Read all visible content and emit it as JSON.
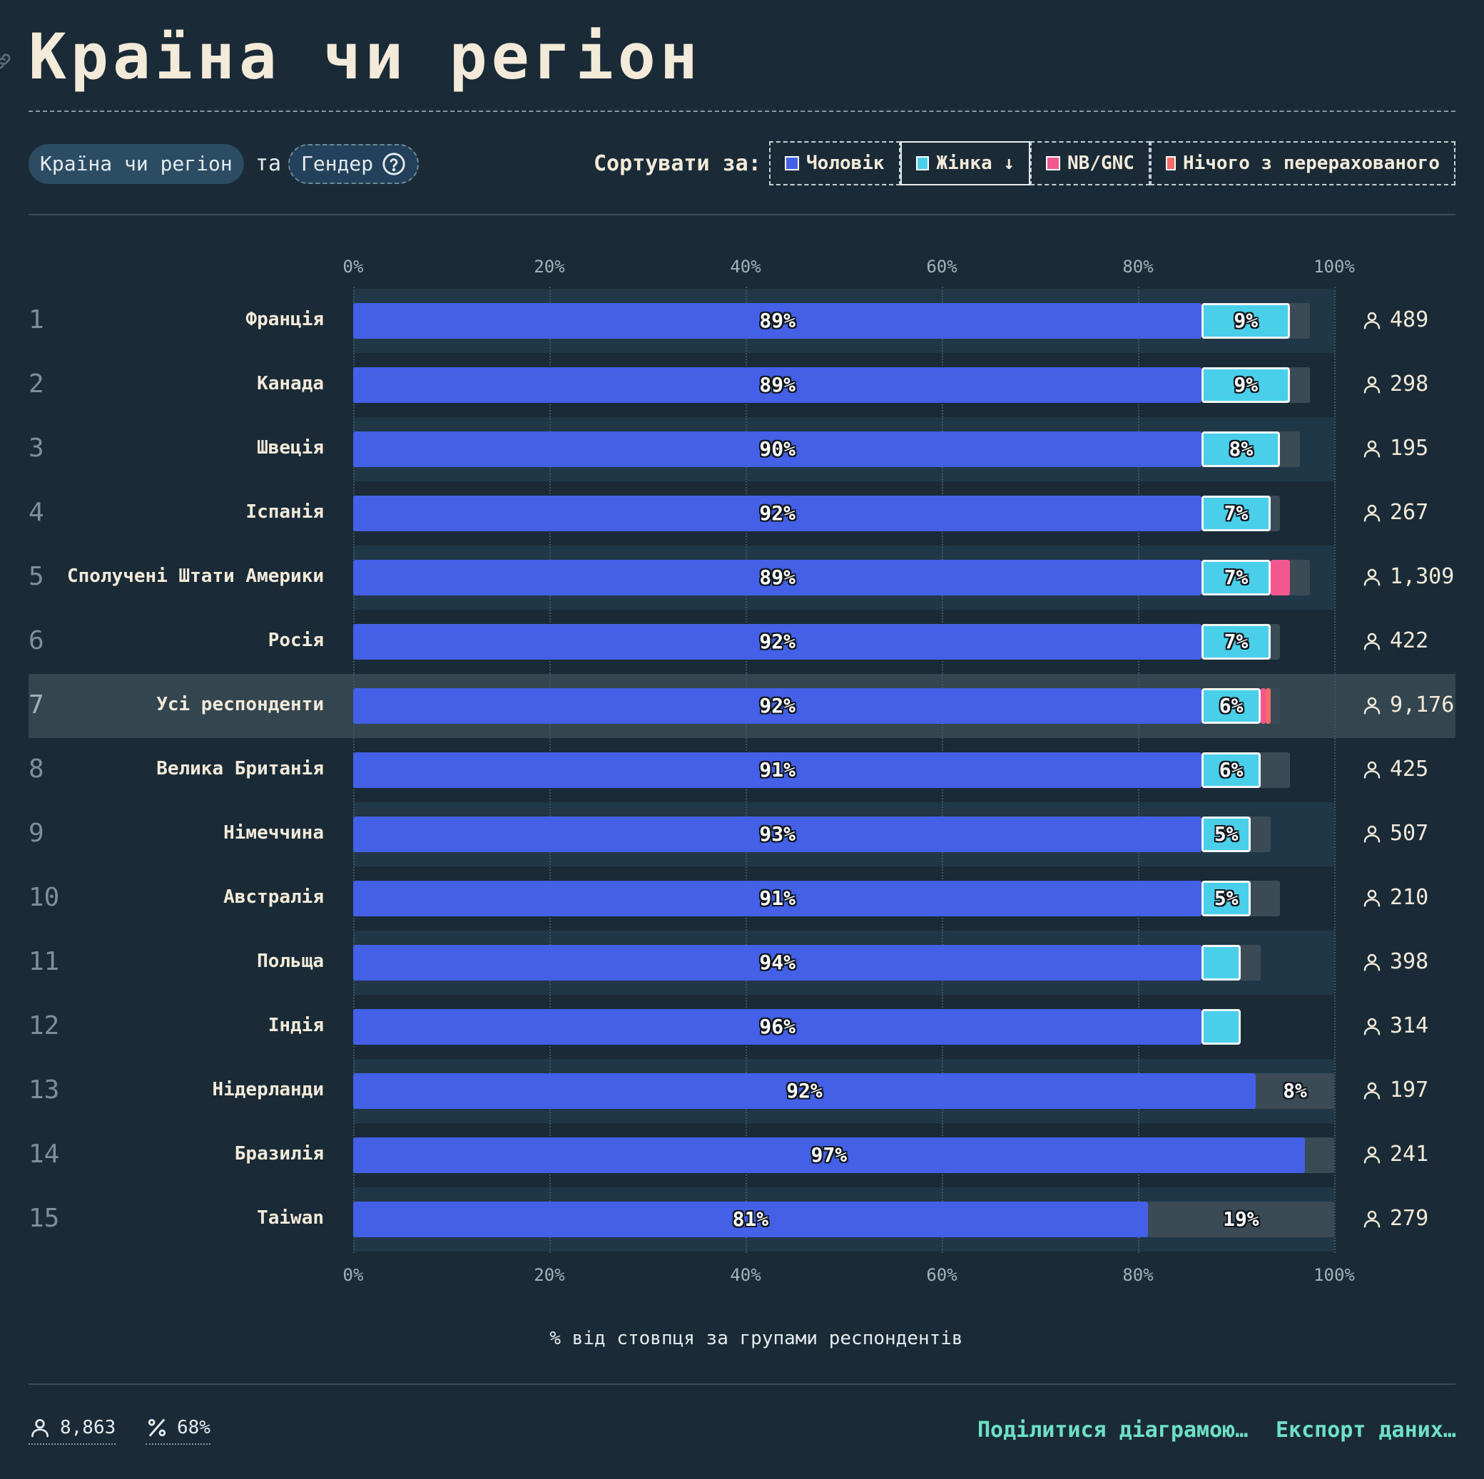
{
  "header": {
    "title": "Країна чи регіон"
  },
  "controls": {
    "group_by_label": "Країна чи регіон",
    "conjunction": "та",
    "breakdown_label": "Гендер",
    "sort_label": "Сортувати за:",
    "sort_options": [
      {
        "label": "Чоловік",
        "color": "#4360e6",
        "active": false
      },
      {
        "label": "Жінка ↓",
        "color": "#49cfea",
        "active": true
      },
      {
        "label": "NB/GNC",
        "color": "#f2578f",
        "active": false
      },
      {
        "label": "Нічого з перерахованого",
        "color": "#f76b6b",
        "active": false
      }
    ]
  },
  "chart_data": {
    "type": "bar",
    "orientation": "horizontal",
    "stacked": true,
    "xlabel": "% від стовпця за групами респондентів",
    "xlim": [
      0,
      100
    ],
    "x_ticks": [
      "0%",
      "20%",
      "40%",
      "60%",
      "80%",
      "100%"
    ],
    "legend": [
      "Чоловік",
      "Жінка",
      "NB/GNC",
      "Нічого з перерахованого"
    ],
    "colors": {
      "male": "#4360e6",
      "female": "#49cfea",
      "nb": "#f2578f",
      "none": "#f76b6b",
      "rest": "#3b4b56"
    },
    "rows": [
      {
        "rank": "1",
        "country": "Франція",
        "male": 89,
        "female": 9,
        "nb": 0,
        "none": 0,
        "male_label": "89%",
        "female_label": "9%",
        "count": "489"
      },
      {
        "rank": "2",
        "country": "Канада",
        "male": 89,
        "female": 9,
        "nb": 0,
        "none": 0,
        "male_label": "89%",
        "female_label": "9%",
        "count": "298"
      },
      {
        "rank": "3",
        "country": "Швеція",
        "male": 90,
        "female": 8,
        "nb": 0,
        "none": 0,
        "male_label": "90%",
        "female_label": "8%",
        "count": "195"
      },
      {
        "rank": "4",
        "country": "Іспанія",
        "male": 92,
        "female": 7,
        "nb": 0,
        "none": 0,
        "male_label": "92%",
        "female_label": "7%",
        "count": "267"
      },
      {
        "rank": "5",
        "country": "Сполучені Штати Америки",
        "male": 89,
        "female": 7,
        "nb": 2,
        "none": 0,
        "male_label": "89%",
        "female_label": "7%",
        "count": "1,309"
      },
      {
        "rank": "6",
        "country": "Росія",
        "male": 92,
        "female": 7,
        "nb": 0,
        "none": 0,
        "male_label": "92%",
        "female_label": "7%",
        "count": "422"
      },
      {
        "rank": "7",
        "country": "Усі респонденти",
        "male": 92,
        "female": 6,
        "nb": 0.5,
        "none": 0.5,
        "male_label": "92%",
        "female_label": "6%",
        "count": "9,176",
        "highlight": true
      },
      {
        "rank": "8",
        "country": "Велика Британія",
        "male": 91,
        "female": 6,
        "nb": 0,
        "none": 0,
        "male_label": "91%",
        "female_label": "6%",
        "count": "425"
      },
      {
        "rank": "9",
        "country": "Німеччина",
        "male": 93,
        "female": 5,
        "nb": 0,
        "none": 0,
        "male_label": "93%",
        "female_label": "5%",
        "count": "507"
      },
      {
        "rank": "10",
        "country": "Австралія",
        "male": 91,
        "female": 5,
        "nb": 0,
        "none": 0,
        "male_label": "91%",
        "female_label": "5%",
        "count": "210"
      },
      {
        "rank": "11",
        "country": "Польща",
        "male": 94,
        "female": 4,
        "nb": 0,
        "none": 0,
        "male_label": "94%",
        "female_label": "",
        "count": "398"
      },
      {
        "rank": "12",
        "country": "Індія",
        "male": 96,
        "female": 4,
        "nb": 0,
        "none": 0,
        "male_label": "96%",
        "female_label": "",
        "count": "314"
      },
      {
        "rank": "13",
        "country": "Нідерланди",
        "male": 92,
        "female": 0,
        "nb": 0,
        "none": 0,
        "male_label": "92%",
        "female_label": "",
        "rest_label": "8%",
        "count": "197"
      },
      {
        "rank": "14",
        "country": "Бразилія",
        "male": 97,
        "female": 0,
        "nb": 0,
        "none": 0,
        "male_label": "97%",
        "female_label": "",
        "count": "241"
      },
      {
        "rank": "15",
        "country": "Taiwan",
        "male": 81,
        "female": 0,
        "nb": 0,
        "none": 0,
        "male_label": "81%",
        "female_label": "",
        "rest_label": "19%",
        "count": "279"
      }
    ]
  },
  "footer": {
    "respondents": "8,863",
    "percent": "68%",
    "share_label": "Поділитися діаграмою…",
    "export_label": "Експорт даних…"
  }
}
